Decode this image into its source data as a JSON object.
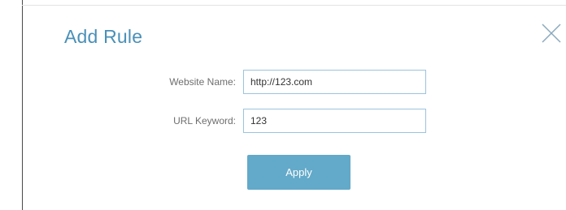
{
  "dialog": {
    "title": "Add Rule",
    "close_icon": "close-icon"
  },
  "form": {
    "website_name": {
      "label": "Website Name:",
      "value": "http://123.com"
    },
    "url_keyword": {
      "label": "URL Keyword:",
      "value": "123"
    },
    "apply_label": "Apply"
  },
  "colors": {
    "title": "#4a90b8",
    "button": "#63a9c9",
    "field_border": "#9bc4dc"
  }
}
